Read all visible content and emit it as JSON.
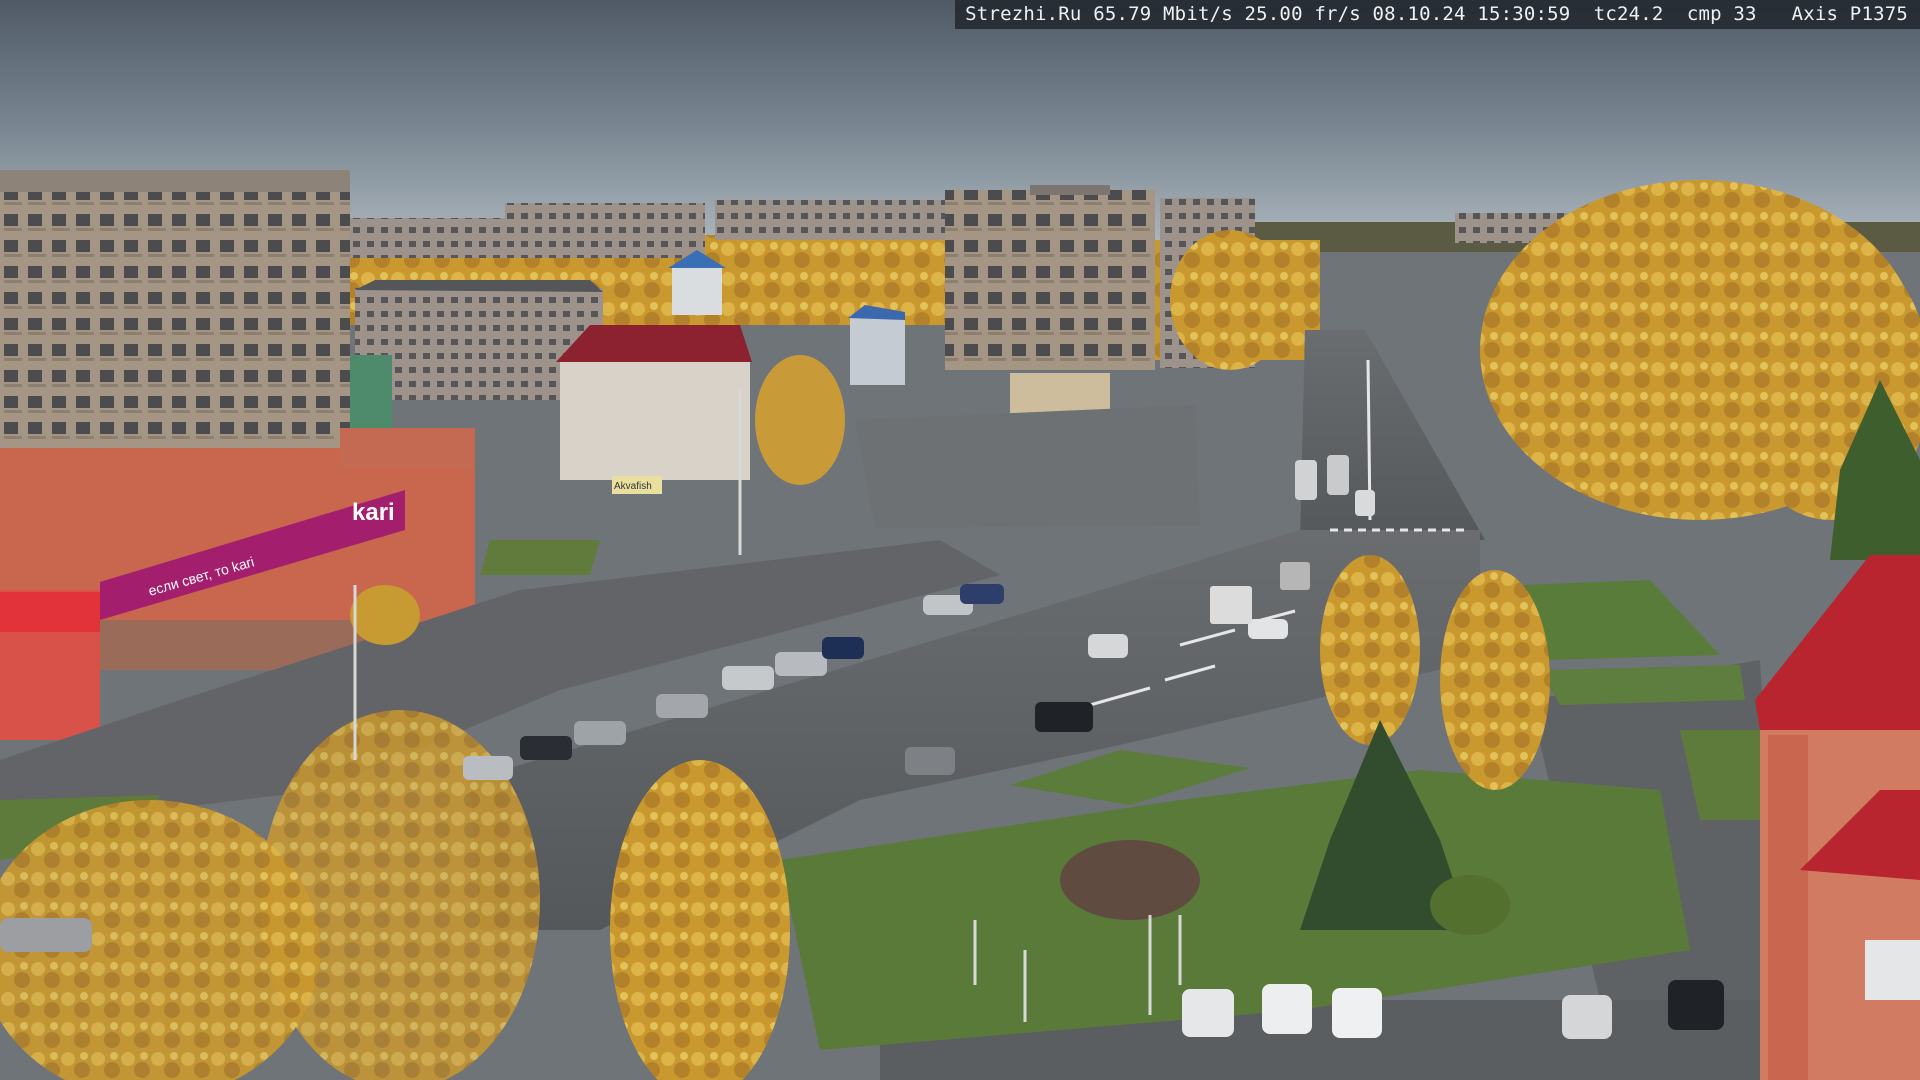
{
  "camera_overlay": {
    "site": "Strezhi.Ru",
    "bitrate": "65.79 Mbit/s",
    "framerate": "25.00 fr/s",
    "date": "08.10.24",
    "time": "15:30:59",
    "tc": "tc24.2",
    "cmp": "cmp 33",
    "model": "Axis P1375"
  },
  "signage": {
    "store_brand": "kari",
    "store_slogan": "если свет, то kari",
    "billboard": "Akvafish"
  },
  "colors": {
    "sky_top": "#4f5a66",
    "sky_bottom": "#aab4bb",
    "asphalt": "#5b5e61",
    "grass": "#5a7a3a",
    "autumn_foliage": "#d2a43a",
    "store_accent": "#a31f6e",
    "building_red": "#b8252e"
  }
}
